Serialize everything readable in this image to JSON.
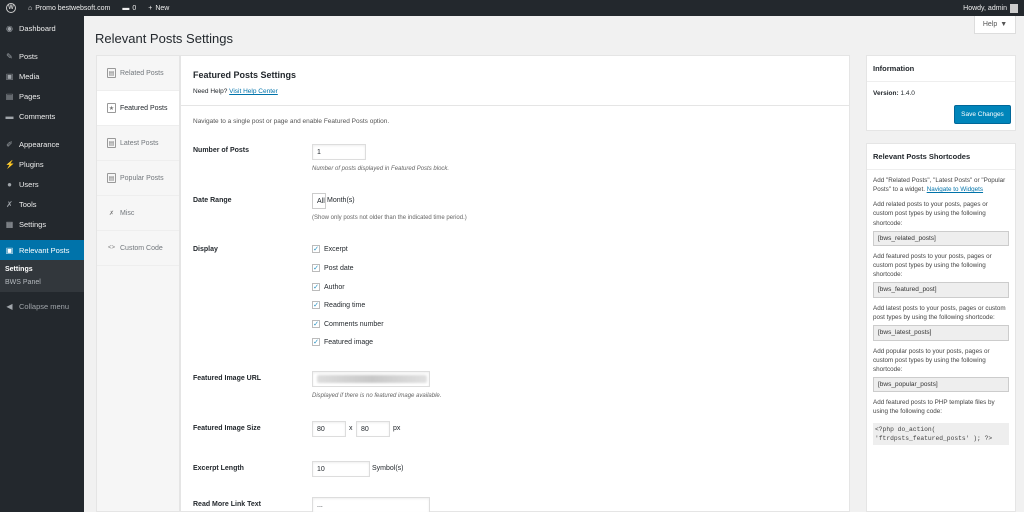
{
  "adminbar": {
    "site_name": "Promo bestwebsoft.com",
    "comments_count": "0",
    "new_label": "New",
    "howdy": "Howdy, admin"
  },
  "sidebar": {
    "items": [
      {
        "icon": "dashboard-icon",
        "glyph": "◉",
        "label": "Dashboard"
      },
      {
        "icon": "pin-icon",
        "glyph": "✎",
        "label": "Posts"
      },
      {
        "icon": "media-icon",
        "glyph": "▣",
        "label": "Media"
      },
      {
        "icon": "pages-icon",
        "glyph": "▤",
        "label": "Pages"
      },
      {
        "icon": "comments-icon",
        "glyph": "▬",
        "label": "Comments"
      },
      {
        "icon": "appearance-icon",
        "glyph": "✐",
        "label": "Appearance"
      },
      {
        "icon": "plugins-icon",
        "glyph": "⚡",
        "label": "Plugins"
      },
      {
        "icon": "users-icon",
        "glyph": "●",
        "label": "Users"
      },
      {
        "icon": "tools-icon",
        "glyph": "✗",
        "label": "Tools"
      },
      {
        "icon": "settings-icon",
        "glyph": "▦",
        "label": "Settings"
      },
      {
        "icon": "relevant-posts-icon",
        "glyph": "▣",
        "label": "Relevant Posts"
      }
    ],
    "submenu": [
      "Settings",
      "BWS Panel"
    ],
    "collapse_label": "Collapse menu"
  },
  "help_tab": {
    "label": "Help",
    "arrow": "▼"
  },
  "page_title": "Relevant Posts Settings",
  "tabs": [
    {
      "label": "Related Posts",
      "glyph": "▤"
    },
    {
      "label": "Featured Posts",
      "glyph": "★"
    },
    {
      "label": "Latest Posts",
      "glyph": "▤"
    },
    {
      "label": "Popular Posts",
      "glyph": "▤"
    },
    {
      "label": "Misc",
      "glyph": "✗"
    },
    {
      "label": "Custom Code",
      "glyph": "<>"
    }
  ],
  "panel": {
    "heading": "Featured Posts Settings",
    "need_help": "Need Help?",
    "help_link": "Visit Help Center",
    "note": "Navigate to a single post or page and enable Featured Posts option.",
    "number_of_posts": {
      "label": "Number of Posts",
      "value": "1",
      "desc": "Number of posts displayed in Featured Posts block."
    },
    "date_range": {
      "label": "Date Range",
      "select": "All",
      "unit": "Month(s)",
      "desc": "(Show only posts not older than the indicated time period.)"
    },
    "display": {
      "label": "Display",
      "options": [
        "Excerpt",
        "Post date",
        "Author",
        "Reading time",
        "Comments number",
        "Featured image"
      ],
      "check": "✓"
    },
    "featured_image_url": {
      "label": "Featured Image URL",
      "desc": "Displayed if there is no featured image available."
    },
    "featured_image_size": {
      "label": "Featured Image Size",
      "width": "80",
      "x": "x",
      "height": "80",
      "unit": "px"
    },
    "excerpt_length": {
      "label": "Excerpt Length",
      "value": "10",
      "unit": "Symbol(s)"
    },
    "read_more": {
      "label": "Read More Link Text",
      "value": "..."
    }
  },
  "info_box": {
    "heading": "Information",
    "version_label": "Version:",
    "version": "1.4.0",
    "save_label": "Save Changes"
  },
  "shortcodes_box": {
    "heading": "Relevant Posts Shortcodes",
    "intro": "Add \"Related Posts\", \"Latest Posts\" or \"Popular Posts\" to a widget.",
    "intro_link": "Navigate to Widgets",
    "related_text": "Add related posts to your posts, pages or custom post types by using the following shortcode:",
    "related_code": "[bws_related_posts]",
    "featured_text": "Add featured posts to your posts, pages or custom post types by using the following shortcode:",
    "featured_code": "[bws_featured_post]",
    "latest_text": "Add latest posts to your posts, pages or custom post types by using the following shortcode:",
    "latest_code": "[bws_latest_posts]",
    "popular_text": "Add popular posts to your posts, pages or custom post types by using the following shortcode:",
    "popular_code": "[bws_popular_posts]",
    "php_text": "Add featured posts to PHP template files by using the following code:",
    "php_code": "<?php do_action( 'ftrdpsts_featured_posts' ); ?>"
  }
}
